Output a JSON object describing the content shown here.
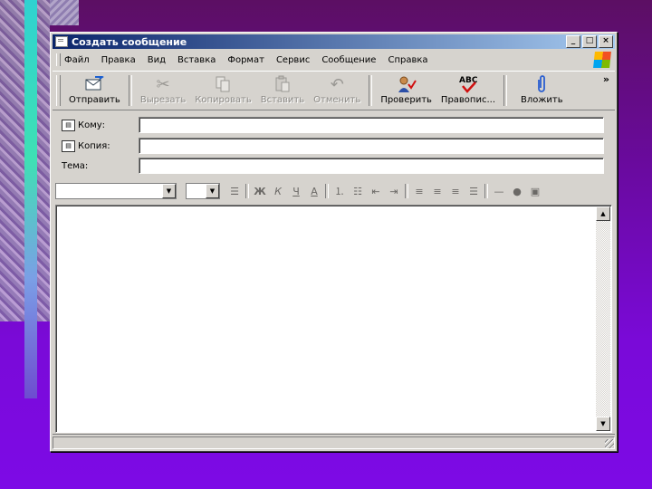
{
  "window": {
    "title": "Создать сообщение",
    "controls": {
      "minimize": "_",
      "maximize": "□",
      "close": "×"
    }
  },
  "menu": [
    "Файл",
    "Правка",
    "Вид",
    "Вставка",
    "Формат",
    "Сервис",
    "Сообщение",
    "Справка"
  ],
  "toolbar": {
    "send": "Отправить",
    "cut": "Вырезать",
    "copy": "Копировать",
    "paste": "Вставить",
    "undo": "Отменить",
    "check": "Проверить",
    "spelling": "Правопис...",
    "attach": "Вложить",
    "more": "»",
    "icons": {
      "send": "send-icon",
      "cut": "scissors-icon",
      "copy": "copy-icon",
      "paste": "paste-icon",
      "undo": "undo-icon",
      "check": "check-names-icon",
      "spelling": "abc-spelling-icon",
      "attach": "paperclip-icon"
    },
    "spelling_icon_text": "ABC"
  },
  "header": {
    "to_label": "Кому:",
    "cc_label": "Копия:",
    "subject_label": "Тема:",
    "to_value": "",
    "cc_value": "",
    "subject_value": ""
  },
  "format_bar": {
    "font_name": "",
    "font_size": "",
    "icons": {
      "paragraph": "paragraph-style-icon",
      "bold": "bold-icon",
      "italic": "italic-icon",
      "underline": "underline-icon",
      "color": "font-color-icon",
      "numbered": "numbered-list-icon",
      "bullets": "bullet-list-icon",
      "outdent": "outdent-icon",
      "indent": "indent-icon",
      "align_left": "align-left-icon",
      "align_center": "align-center-icon",
      "align_right": "align-right-icon",
      "justify": "justify-icon",
      "hr": "horizontal-line-icon",
      "link": "hyperlink-icon",
      "image": "insert-image-icon"
    },
    "glyphs": {
      "bold": "Ж",
      "italic": "К",
      "underline": "Ч",
      "color": "А"
    }
  },
  "colors": {
    "title_start": "#0a246a",
    "title_end": "#a6caf0",
    "face": "#d6d3ce",
    "slide_bg": "#7a0ad8"
  }
}
